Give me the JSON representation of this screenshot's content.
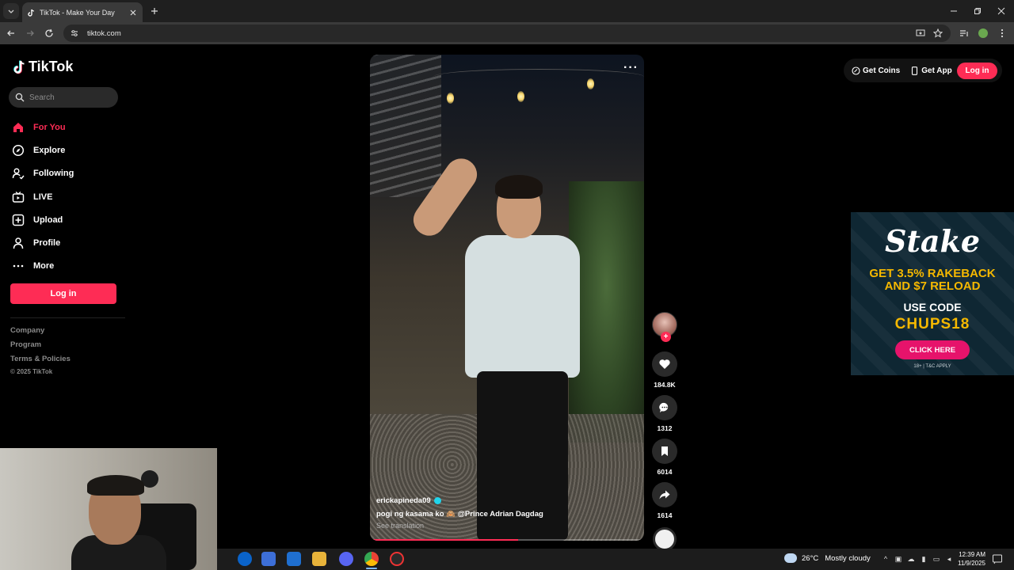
{
  "browser": {
    "tab_title": "TikTok - Make Your Day",
    "url": "tiktok.com"
  },
  "sidebar": {
    "logo_text": "TikTok",
    "search_placeholder": "Search",
    "items": [
      {
        "label": "For You",
        "icon": "home-icon",
        "active": true
      },
      {
        "label": "Explore",
        "icon": "compass-icon",
        "active": false
      },
      {
        "label": "Following",
        "icon": "following-icon",
        "active": false
      },
      {
        "label": "LIVE",
        "icon": "live-icon",
        "active": false
      },
      {
        "label": "Upload",
        "icon": "upload-icon",
        "active": false
      },
      {
        "label": "Profile",
        "icon": "profile-icon",
        "active": false
      },
      {
        "label": "More",
        "icon": "more-icon",
        "active": false
      }
    ],
    "login_label": "Log in",
    "footer": [
      "Company",
      "Program",
      "Terms & Policies"
    ],
    "copyright": "© 2025 TikTok"
  },
  "video": {
    "username": "erickapineda09",
    "caption": "pogi ng kasama ko 🙈",
    "mention": "@Prince Adrian Dagdag",
    "see_translation": "See translation",
    "progress": 0.54
  },
  "actions": {
    "likes": "184.8K",
    "comments": "1312",
    "saves": "6014",
    "shares": "1614"
  },
  "header": {
    "get_coins": "Get Coins",
    "get_app": "Get App",
    "login": "Log in"
  },
  "ad": {
    "brand": "Stake",
    "line1": "GET 3.5% RAKEBACK",
    "line2": "AND $7 RELOAD",
    "code_label": "USE CODE",
    "code": "CHUPS18",
    "cta": "CLICK HERE",
    "tc": "18+ | T&C APPLY"
  },
  "taskbar": {
    "temperature": "26°C",
    "weather": "Mostly cloudy",
    "time": "12:39 AM",
    "date": "11/9/2025"
  },
  "colors": {
    "brand": "#fe2c55",
    "ad_bg": "#0f2733",
    "ad_accent": "#f5b800"
  }
}
